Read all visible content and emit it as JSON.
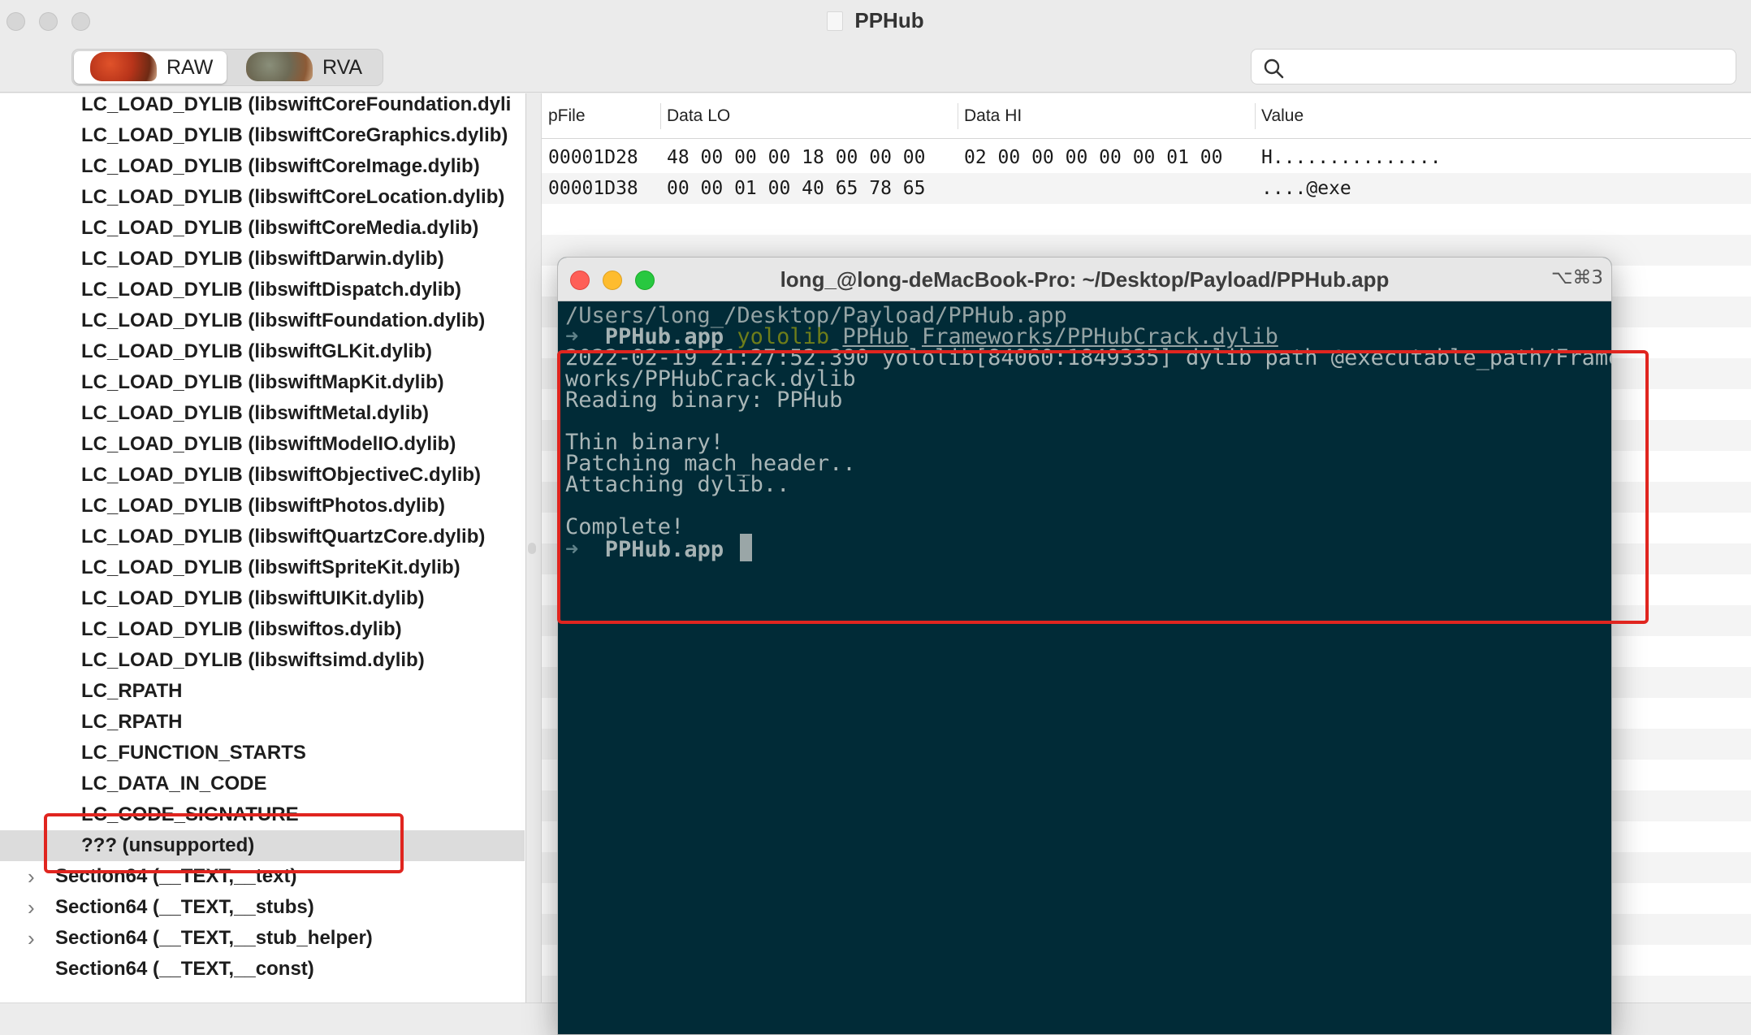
{
  "window": {
    "title": "PPHub"
  },
  "toolbar": {
    "segments": [
      {
        "label": "RAW",
        "icon": "raw-artwork-icon"
      },
      {
        "label": "RVA",
        "icon": "rva-artwork-icon"
      }
    ],
    "search_placeholder": ""
  },
  "sidebar": {
    "items": [
      {
        "label": "LC_LOAD_DYLIB (libswiftCoreFoundation.dyli"
      },
      {
        "label": "LC_LOAD_DYLIB (libswiftCoreGraphics.dylib)"
      },
      {
        "label": "LC_LOAD_DYLIB (libswiftCoreImage.dylib)"
      },
      {
        "label": "LC_LOAD_DYLIB (libswiftCoreLocation.dylib)"
      },
      {
        "label": "LC_LOAD_DYLIB (libswiftCoreMedia.dylib)"
      },
      {
        "label": "LC_LOAD_DYLIB (libswiftDarwin.dylib)"
      },
      {
        "label": "LC_LOAD_DYLIB (libswiftDispatch.dylib)"
      },
      {
        "label": "LC_LOAD_DYLIB (libswiftFoundation.dylib)"
      },
      {
        "label": "LC_LOAD_DYLIB (libswiftGLKit.dylib)"
      },
      {
        "label": "LC_LOAD_DYLIB (libswiftMapKit.dylib)"
      },
      {
        "label": "LC_LOAD_DYLIB (libswiftMetal.dylib)"
      },
      {
        "label": "LC_LOAD_DYLIB (libswiftModelIO.dylib)"
      },
      {
        "label": "LC_LOAD_DYLIB (libswiftObjectiveC.dylib)"
      },
      {
        "label": "LC_LOAD_DYLIB (libswiftPhotos.dylib)"
      },
      {
        "label": "LC_LOAD_DYLIB (libswiftQuartzCore.dylib)"
      },
      {
        "label": "LC_LOAD_DYLIB (libswiftSpriteKit.dylib)"
      },
      {
        "label": "LC_LOAD_DYLIB (libswiftUIKit.dylib)"
      },
      {
        "label": "LC_LOAD_DYLIB (libswiftos.dylib)"
      },
      {
        "label": "LC_LOAD_DYLIB (libswiftsimd.dylib)"
      },
      {
        "label": "LC_RPATH"
      },
      {
        "label": "LC_RPATH"
      },
      {
        "label": "LC_FUNCTION_STARTS"
      },
      {
        "label": "LC_DATA_IN_CODE"
      },
      {
        "label": "LC_CODE_SIGNATURE"
      },
      {
        "label": "??? (unsupported)",
        "selected": true
      },
      {
        "label": "Section64 (__TEXT,__text)",
        "expandable": true
      },
      {
        "label": "Section64 (__TEXT,__stubs)",
        "expandable": true
      },
      {
        "label": "Section64 (__TEXT,__stub_helper)",
        "expandable": true
      },
      {
        "label": "Section64 (__TEXT,__const)"
      }
    ]
  },
  "hex_table": {
    "columns": [
      "pFile",
      "Data LO",
      "Data HI",
      "Value"
    ],
    "rows": [
      {
        "pfile": "00001D28",
        "data_lo": "48 00 00 00 18 00 00 00",
        "data_hi": "02 00 00 00 00 00 01 00",
        "value": "H..............."
      },
      {
        "pfile": "00001D38",
        "data_lo": "00 00 01 00 40 65 78 65",
        "data_hi": "",
        "value": "....@exe"
      }
    ]
  },
  "terminal": {
    "title": "long_@long-deMacBook-Pro: ~/Desktop/Payload/PPHub.app",
    "shortcut": "⌥⌘3",
    "lines": {
      "path": "/Users/long_/Desktop/Payload/PPHub.app",
      "prompt_arrow": "➜",
      "prompt_dir": "PPHub.app",
      "cmd_name": "yololib",
      "cmd_arg1": "PPHub",
      "cmd_arg2": "Frameworks/PPHubCrack.dylib",
      "out1": "2022-02-19 21:27:52.390 yololib[84060:1849335] dylib path @executable_path/Frame",
      "out2": "works/PPHubCrack.dylib",
      "out3": "Reading binary: PPHub",
      "out4": "Thin binary!",
      "out5": "Patching mach_header..",
      "out6": "Attaching dylib..",
      "out7": "Complete!",
      "prompt2_dir": "PPHub.app"
    }
  },
  "colors": {
    "terminal_bg": "#012b37",
    "annotation_red": "#e0251f",
    "selection_gray": "#dcdcdc"
  }
}
